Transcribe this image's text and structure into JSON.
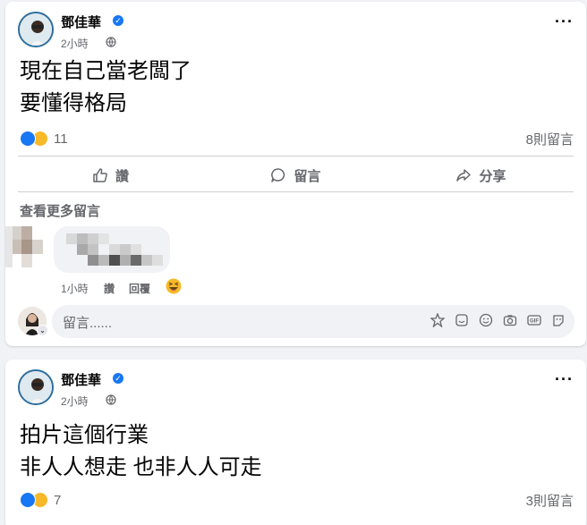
{
  "posts": [
    {
      "author": "鄧佳華",
      "time": "2小時",
      "lines": [
        "現在自己當老闆了",
        "要懂得格局"
      ],
      "reaction_count": "11",
      "comment_count": "8則留言"
    },
    {
      "author": "鄧佳華",
      "time": "2小時",
      "lines": [
        "拍片這個行業",
        "非人人想走 也非人人可走"
      ],
      "reaction_count": "7",
      "comment_count": "3則留言"
    }
  ],
  "actions": {
    "like": "讚",
    "comment": "留言",
    "share": "分享"
  },
  "comments_section": {
    "see_more": "查看更多留言",
    "comment_time": "1小時",
    "like_label": "讚",
    "reply_label": "回覆"
  },
  "composer": {
    "placeholder": "留言......"
  },
  "icons": [
    "verified-badge-icon",
    "globe-icon",
    "more-options-icon",
    "like-icon",
    "comment-icon",
    "share-icon",
    "haha-emoji-icon",
    "avatar-sticker-icon",
    "sticker-icon",
    "emoji-icon",
    "camera-icon",
    "gif-icon",
    "avatar-icon"
  ],
  "colors": {
    "brand_blue": "#1877f2",
    "secondary_text": "#65676b",
    "haha_yellow": "#f7b928"
  }
}
